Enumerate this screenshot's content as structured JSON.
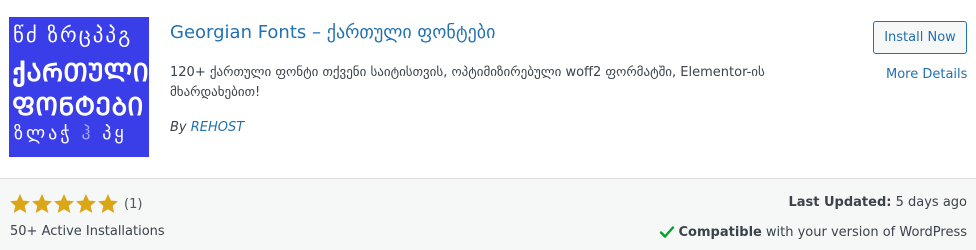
{
  "plugin": {
    "title": "Georgian Fonts – ქართული ფონტები",
    "description": "120+ ქართული ფონტი თქვენი საიტისთვის, ოპტიმიზირებული woff2 ფორმატში, Elementor-ის მხარდახებით!",
    "author_prefix": "By",
    "author": "REHOST",
    "icon": {
      "line1": "წძ ზრცპპგ",
      "line2": "ქᲐᲠᲗᲣᲚᲘ",
      "line3": "ᲤᲝᲜᲢᲔᲑᲘ",
      "line4a": "ზლაჭ",
      "line4b": "ჰ",
      "line4c": "პყ"
    }
  },
  "actions": {
    "install_label": "Install Now",
    "more_details_label": "More Details"
  },
  "footer": {
    "rating": 5,
    "rating_max": 5,
    "rating_count": "(1)",
    "installs": "50+ Active Installations",
    "last_updated_label": "Last Updated:",
    "last_updated_value": "5 days ago",
    "compat_bold": "Compatible",
    "compat_rest": "with your version of WordPress"
  },
  "colors": {
    "accent": "#2271b1",
    "icon_bg": "#3a3ee8",
    "star": "#dba617",
    "check": "#00a32a"
  }
}
